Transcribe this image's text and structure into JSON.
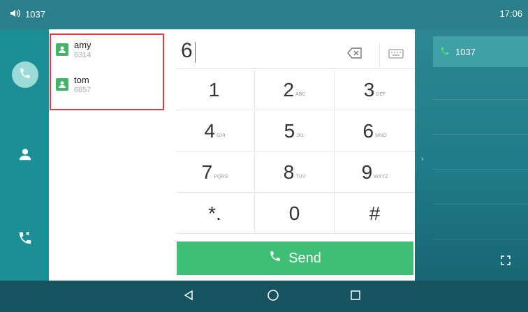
{
  "status": {
    "volume_text": "1037",
    "time": "17:06"
  },
  "contacts": [
    {
      "name": "amy",
      "number": "6314"
    },
    {
      "name": "tom",
      "number": "6857"
    }
  ],
  "dialpad": {
    "input_value": "6",
    "keys": [
      {
        "digit": "1",
        "letters": ""
      },
      {
        "digit": "2",
        "letters": "ABC"
      },
      {
        "digit": "3",
        "letters": "DEF"
      },
      {
        "digit": "4",
        "letters": "GHI"
      },
      {
        "digit": "5",
        "letters": "JKL"
      },
      {
        "digit": "6",
        "letters": "MNO"
      },
      {
        "digit": "7",
        "letters": "PQRS"
      },
      {
        "digit": "8",
        "letters": "TUV"
      },
      {
        "digit": "9",
        "letters": "WXYZ"
      },
      {
        "digit": "*.",
        "letters": ""
      },
      {
        "digit": "0",
        "letters": ""
      },
      {
        "digit": "#",
        "letters": ""
      }
    ],
    "send_label": "Send"
  },
  "line": {
    "label": "1037"
  },
  "colors": {
    "accent_green": "#3fbf76",
    "teal": "#1f7b87",
    "highlight_red": "#e0393e"
  }
}
